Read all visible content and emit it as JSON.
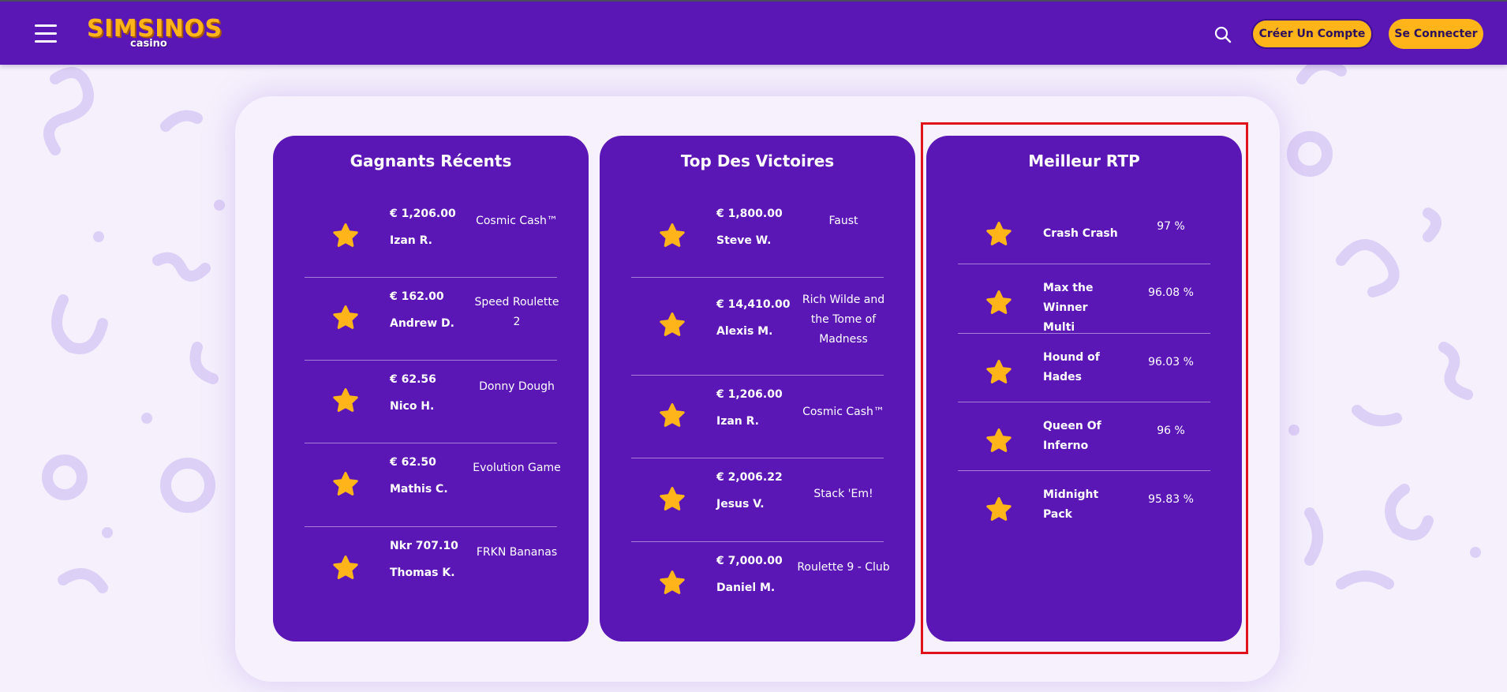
{
  "header": {
    "logo_main": "SIMSINOS",
    "logo_sub": "casino",
    "register_label": "Créer Un Compte",
    "login_label": "Se Connecter"
  },
  "colors": {
    "brand_purple": "#5b17b6",
    "accent_yellow": "#ffb51a",
    "highlight_red": "#e0121c"
  },
  "icons": {
    "menu": "hamburger-icon",
    "search": "search-icon",
    "row": "star-icon"
  },
  "recent_winners": {
    "title": "Gagnants Récents",
    "rows": [
      {
        "amount": "€ 1,206.00",
        "player": "Izan R.",
        "game": "Cosmic Cash™"
      },
      {
        "amount": "€ 162.00",
        "player": "Andrew D.",
        "game": "Speed Roulette 2"
      },
      {
        "amount": "€ 62.56",
        "player": "Nico H.",
        "game": "Donny Dough"
      },
      {
        "amount": "€ 62.50",
        "player": "Mathis C.",
        "game": "Evolution Game"
      },
      {
        "amount": "Nkr 707.10",
        "player": "Thomas K.",
        "game": "FRKN Bananas"
      }
    ]
  },
  "top_wins": {
    "title": "Top Des Victoires",
    "rows": [
      {
        "amount": "€ 1,800.00",
        "player": "Steve W.",
        "game": "Faust"
      },
      {
        "amount": "€ 14,410.00",
        "player": "Alexis M.",
        "game": "Rich Wilde and the Tome of Madness"
      },
      {
        "amount": "€ 1,206.00",
        "player": "Izan R.",
        "game": "Cosmic Cash™"
      },
      {
        "amount": "€ 2,006.22",
        "player": "Jesus V.",
        "game": "Stack 'Em!"
      },
      {
        "amount": "€ 7,000.00",
        "player": "Daniel M.",
        "game": "Roulette 9 - Club"
      }
    ]
  },
  "best_rtp": {
    "title": "Meilleur RTP",
    "rows": [
      {
        "game": "Crash Crash",
        "rtp": "97 %"
      },
      {
        "game": "Max the Winner Multi",
        "rtp": "96.08 %"
      },
      {
        "game": "Hound of Hades",
        "rtp": "96.03 %"
      },
      {
        "game": "Queen Of Inferno",
        "rtp": "96 %"
      },
      {
        "game": "Midnight Pack",
        "rtp": "95.83 %"
      }
    ]
  }
}
